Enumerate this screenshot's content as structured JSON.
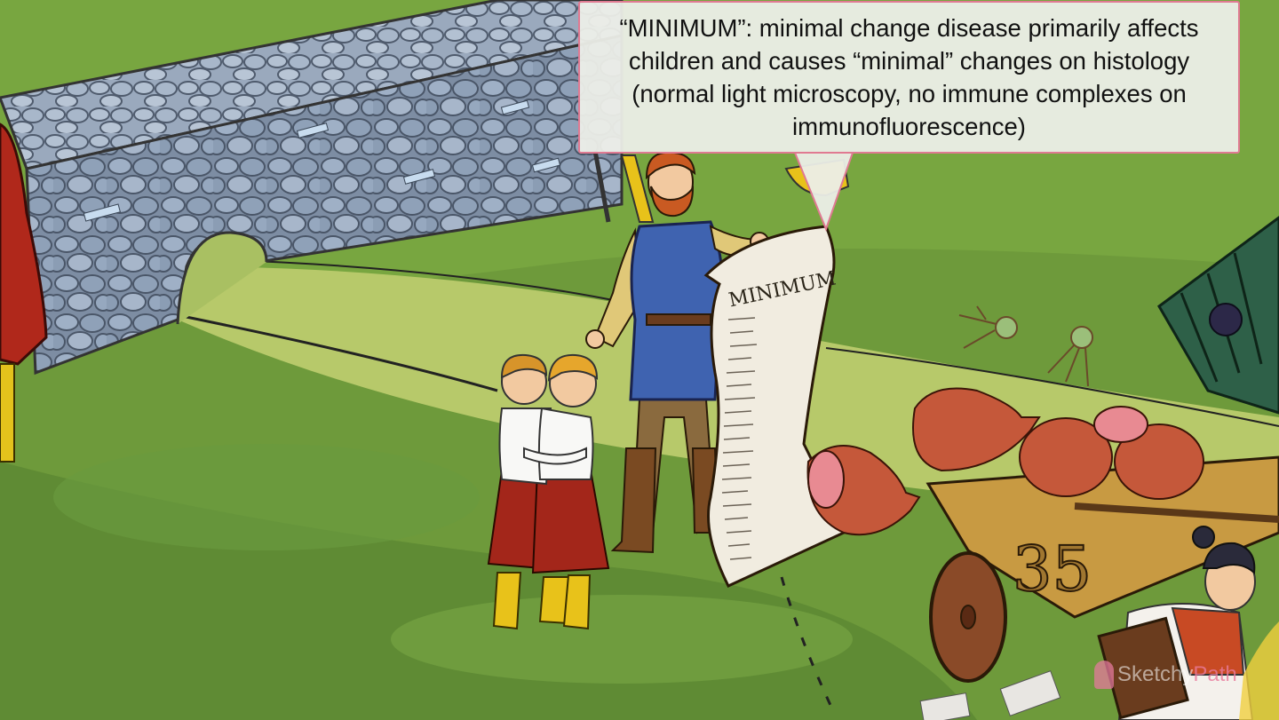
{
  "callout": {
    "text": "“MINIMUM”: minimal change disease primarily affects children and causes “minimal” changes on histology (normal light microscopy, no immune complexes on immunofluorescence)"
  },
  "scroll": {
    "title": "MINIMUM"
  },
  "cart": {
    "number": "35"
  },
  "watermark": {
    "part1": "Sketchy",
    "part2": "Path"
  },
  "colors": {
    "callout_border": "#e07a92",
    "grass": "#6f9a3a",
    "wall_stone": "#8c9bb0",
    "tunic_blue": "#3f63b0",
    "skirt_red": "#a3261a",
    "boots_yellow": "#e8c21a"
  }
}
